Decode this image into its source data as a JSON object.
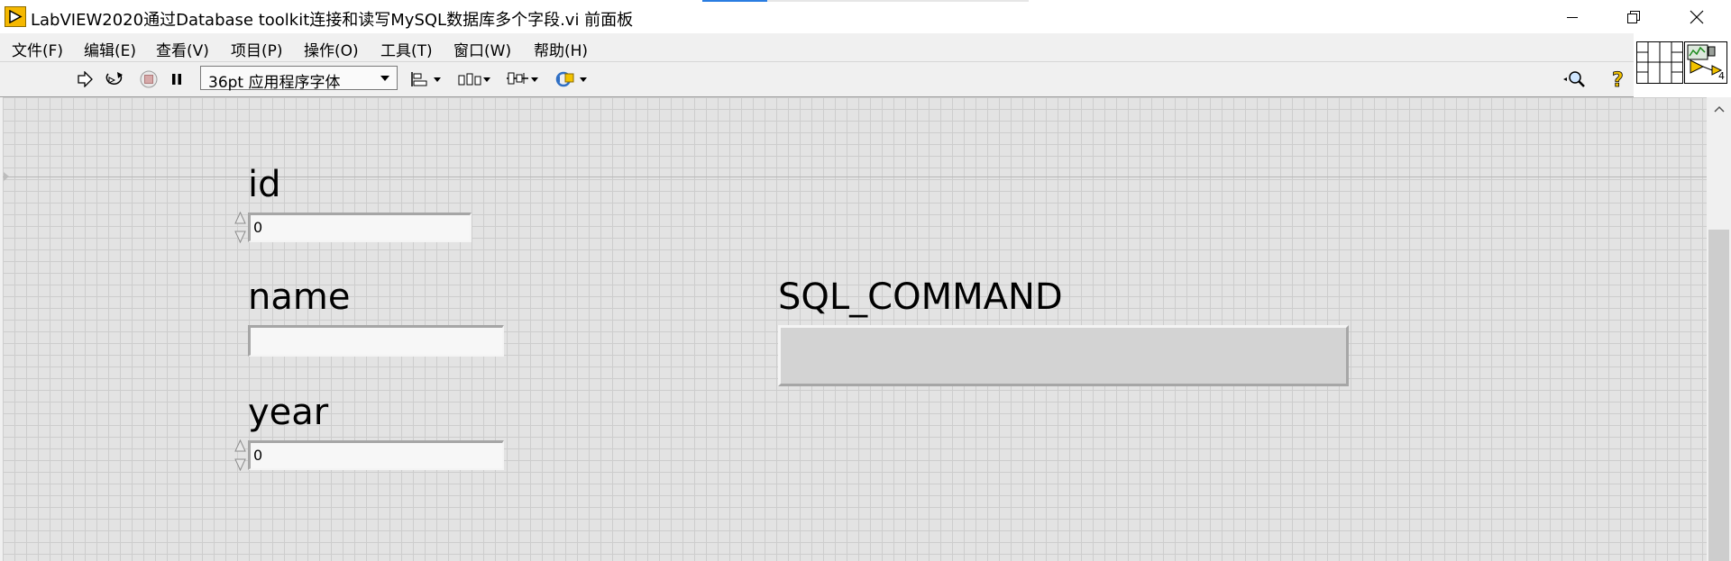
{
  "window": {
    "title": "LabVIEW2020通过Database toolkit连接和读写MySQL数据库多个字段.vi 前面板"
  },
  "menu": {
    "items": [
      {
        "label": "文件(F)"
      },
      {
        "label": "编辑(E)"
      },
      {
        "label": "查看(V)"
      },
      {
        "label": "项目(P)"
      },
      {
        "label": "操作(O)"
      },
      {
        "label": "工具(T)"
      },
      {
        "label": "窗口(W)"
      },
      {
        "label": "帮助(H)"
      }
    ]
  },
  "toolbar": {
    "font_selector": "36pt 应用程序字体",
    "icons": [
      "run-arrow-icon",
      "run-continuously-icon",
      "abort-icon",
      "pause-icon",
      "align-objects-icon",
      "distribute-objects-icon",
      "resize-objects-icon",
      "reorder-icon",
      "search-icon",
      "help-icon"
    ]
  },
  "connector": {
    "terminal_count": "4"
  },
  "controls": {
    "id": {
      "label": "id",
      "value": "0"
    },
    "name": {
      "label": "name",
      "value": ""
    },
    "year": {
      "label": "year",
      "value": "0"
    },
    "sql_command": {
      "label": "SQL_COMMAND",
      "value": ""
    }
  },
  "colors": {
    "panel": "#e3e3e3",
    "grid": "#cdcdcd",
    "title_accent": "#2a7de1",
    "app_icon": "#f5b800"
  }
}
